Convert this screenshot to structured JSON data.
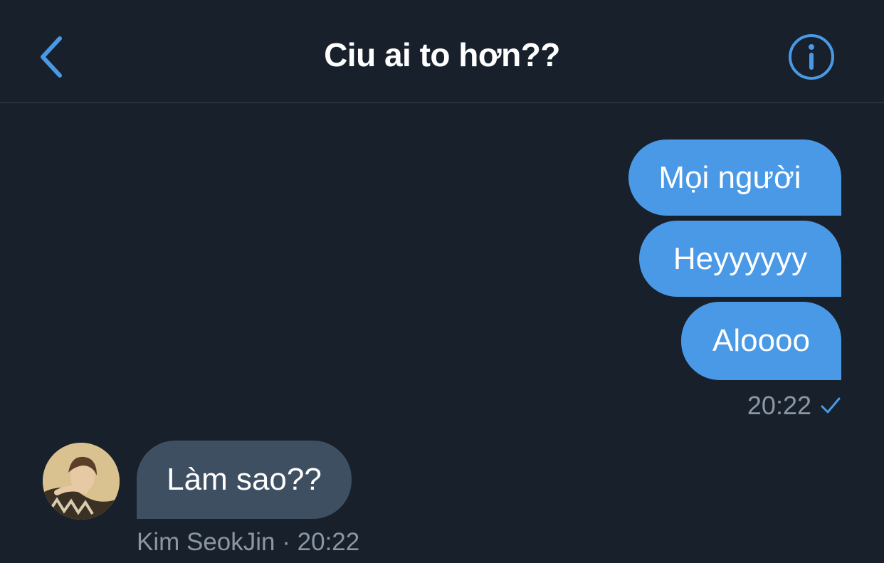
{
  "header": {
    "title": "Ciu ai to hơn??",
    "back_icon": "chevron-left-icon",
    "info_icon": "info-icon",
    "accent_color": "#4a99e6"
  },
  "messages_out": [
    {
      "text": "Mọi người"
    },
    {
      "text": "Heyyyyyy"
    },
    {
      "text": "Aloooo"
    }
  ],
  "out_meta": {
    "time": "20:22",
    "status_icon": "check-icon"
  },
  "message_in": {
    "text": "Làm sao??",
    "sender": "Kim SeokJin",
    "separator": "·",
    "time": "20:22"
  },
  "colors": {
    "background": "#17202b",
    "outgoing_bubble": "#4a99e6",
    "incoming_bubble": "#3e4f61",
    "meta_text": "#8b97a4"
  }
}
